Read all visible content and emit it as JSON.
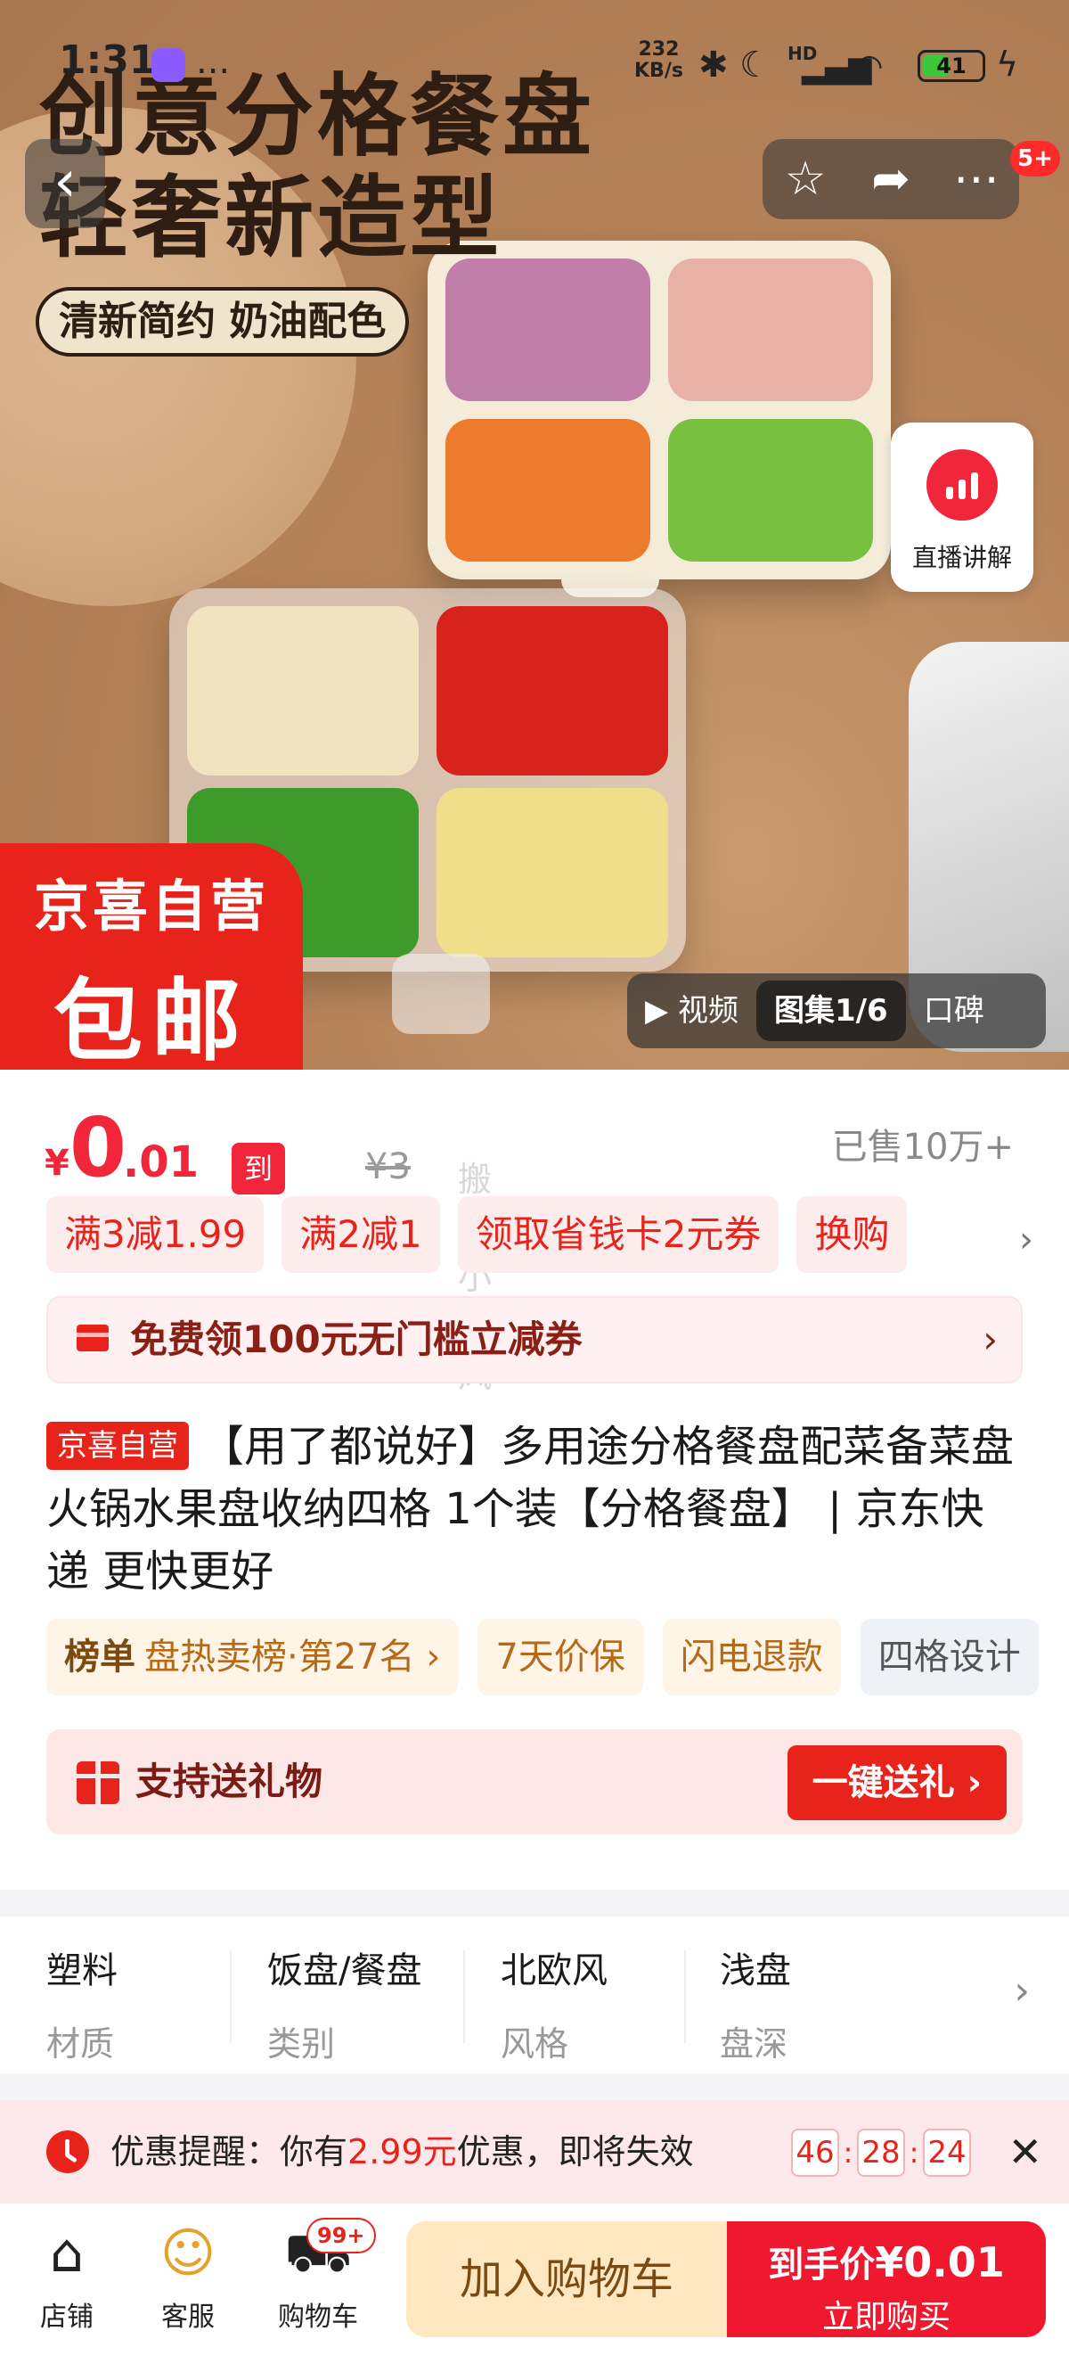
{
  "status_bar": {
    "time": "1:31",
    "more": "...",
    "net_speed_value": "232",
    "net_speed_unit": "KB/s",
    "network": "HD",
    "battery": "41"
  },
  "hero": {
    "title_line1": "创意分格餐盘",
    "title_line2": "轻奢新造型",
    "tagline": "清新简约 奶油配色",
    "notification_badge": "5+",
    "live_label": "直播讲解",
    "badge_line1": "京喜自营",
    "badge_line2": "包邮",
    "media_tabs": [
      "▶ 视频",
      "图集1/6",
      "口碑"
    ]
  },
  "price": {
    "currency": "¥",
    "integer": "0",
    "decimal": ".01",
    "label": "到手价",
    "original": "¥3",
    "watermark": "搬砖小旋风",
    "sold": "已售10万+"
  },
  "coupons": [
    "满3减1.99",
    "满2减1",
    "领取省钱卡2元券",
    "换购"
  ],
  "free_coupon": "免费领100元无门槛立减券",
  "product": {
    "tag": "京喜自营",
    "title": "【用了都说好】多用途分格餐盘配菜备菜盘火锅水果盘收纳四格 1个装【分格餐盘】 | 京东快递 更快更好"
  },
  "chips": {
    "rank_label": "榜单",
    "rank_text": "盘热卖榜·第27名 ›",
    "items": [
      "7天价保",
      "闪电退款",
      "四格设计"
    ]
  },
  "gift": {
    "text": "支持送礼物",
    "button": "一键送礼 ›"
  },
  "attributes": [
    {
      "value": "塑料",
      "key": "材质"
    },
    {
      "value": "饭盘/餐盘",
      "key": "类别"
    },
    {
      "value": "北欧风",
      "key": "风格"
    },
    {
      "value": "浅盘",
      "key": "盘深"
    }
  ],
  "reminder": {
    "prefix": "优惠提醒：你有",
    "amount": "2.99元",
    "suffix": "优惠，即将失效",
    "timer": [
      "46",
      "28",
      "24"
    ]
  },
  "bottom": {
    "nav": [
      {
        "icon": "store-icon",
        "label": "店铺"
      },
      {
        "icon": "service-icon",
        "label": "客服"
      },
      {
        "icon": "cart-icon",
        "label": "购物车"
      }
    ],
    "cart_count": "99+",
    "add_to_cart": "加入购物车",
    "buy_price_label": "到手价",
    "buy_price": "¥0.01",
    "buy_now": "立即购买"
  },
  "colors": {
    "accent": "#f2263a",
    "jx_red": "#e8231b",
    "cart_bg": "#ffe7c2"
  }
}
